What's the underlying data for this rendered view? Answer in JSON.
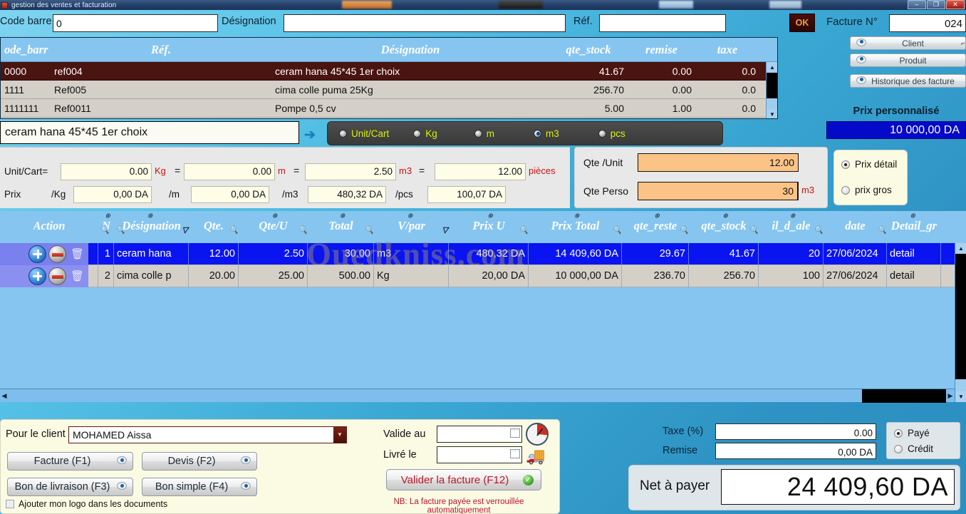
{
  "window": {
    "title": "gestion des ventes et facturation",
    "minimize": "–",
    "maximize": "❐",
    "close": "✕"
  },
  "search": {
    "codebarre_label": "Code barre",
    "codebarre_value": "0",
    "designation_label": "Désignation",
    "designation_value": "",
    "ref_label": "Réf.",
    "ref_value": "",
    "ok_label": "OK",
    "facture_no_label": "Facture N°",
    "facture_no_value": "024"
  },
  "side_buttons": {
    "client": "Client",
    "produit": "Produit",
    "historique": "Historique des facture",
    "prix_perso_label": "Prix personnalisé",
    "prix_perso_value": "10 000,00 DA"
  },
  "product_grid": {
    "columns": [
      "ode_barr",
      "Réf.",
      "Désignation",
      "qte_stock",
      "remise",
      "taxe"
    ],
    "rows": [
      {
        "code": "0000",
        "ref": "ref004",
        "designation": "ceram hana 45*45 1er choix",
        "qte_stock": "41.67",
        "remise": "0.00",
        "taxe": "0.0",
        "selected": true
      },
      {
        "code": "1111",
        "ref": "Ref005",
        "designation": "cima colle puma 25Kg",
        "qte_stock": "256.70",
        "remise": "0.00",
        "taxe": "0.0",
        "selected": false
      },
      {
        "code": "1111111",
        "ref": "Ref0011",
        "designation": "Pompe 0,5 cv",
        "qte_stock": "5.00",
        "remise": "1.00",
        "taxe": "0.0",
        "selected": false
      }
    ],
    "scroll_up": "▲",
    "scroll_down": "▼"
  },
  "selected_product": {
    "designation": "ceram hana 45*45 1er choix",
    "arrow": "➔"
  },
  "unit_selector": {
    "options": [
      {
        "label": "Unit/Cart",
        "selected": false
      },
      {
        "label": "Kg",
        "selected": false
      },
      {
        "label": "m",
        "selected": false
      },
      {
        "label": "m3",
        "selected": true
      },
      {
        "label": "pcs",
        "selected": false
      }
    ]
  },
  "conversion": {
    "row1_label": "Unit/Cart=",
    "kg_value": "0.00",
    "kg_unit": "Kg",
    "eq1": "=",
    "m_value": "0.00",
    "m_unit": "m",
    "eq2": "=",
    "m3_value": "2.50",
    "m3_unit": "m3",
    "eq3": "=",
    "pcs_value": "12.00",
    "pcs_unit": "pièces",
    "row2_label": "Prix",
    "per_kg_label": "/Kg",
    "per_kg_value": "0,00 DA",
    "per_m_label": "/m",
    "per_m_value": "0,00 DA",
    "per_m3_label": "/m3",
    "per_m3_value": "480,32 DA",
    "per_pcs_label": "/pcs",
    "per_pcs_value": "100,07 DA"
  },
  "qte_panel": {
    "qte_unit_label": "Qte /Unit",
    "qte_unit_value": "12.00",
    "qte_perso_label": "Qte Perso",
    "qte_perso_value": "30",
    "qte_perso_unit": "m3"
  },
  "price_type": {
    "detail_label": "Prix détail",
    "detail_selected": true,
    "gros_label": "prix gros",
    "gros_selected": false
  },
  "invoice_grid": {
    "columns": [
      "Action",
      "N",
      "Désignation",
      "Qte.",
      "Qte/U",
      "Total",
      "V/par",
      "Prix U",
      "Prix Total",
      "qte_reste",
      "qte_stock",
      "il_d_ale",
      "date",
      "Detail_gr"
    ],
    "rows": [
      {
        "n": "1",
        "designation": "ceram hana",
        "qte": "12.00",
        "qteu": "2.50",
        "total": "30.00",
        "vpar": "m3",
        "prix_u": "480,32 DA",
        "prix_total": "14 409,60 DA",
        "qte_reste": "29.67",
        "qte_stock": "41.67",
        "seuil": "20",
        "date": "27/06/2024",
        "detail": "detail",
        "selected": true
      },
      {
        "n": "2",
        "designation": "cima colle p",
        "qte": "20.00",
        "qteu": "25.00",
        "total": "500.00",
        "vpar": "Kg",
        "prix_u": "20,00 DA",
        "prix_total": "10 000,00 DA",
        "qte_reste": "236.70",
        "qte_stock": "256.70",
        "seuil": "100",
        "date": "27/06/2024",
        "detail": "detail",
        "selected": false
      }
    ],
    "watermark": "Ouedkniss.com",
    "scroll_up": "▲",
    "scroll_down": "▼",
    "scroll_left": "◀",
    "scroll_right": "▶"
  },
  "bottom": {
    "client_label": "Pour le client",
    "client_value": "MOHAMED Aissa",
    "facture_btn": "Facture (F1)",
    "devis_btn": "Devis (F2)",
    "bl_btn": "Bon de livraison (F3)",
    "bs_btn": "Bon simple (F4)",
    "logo_checkbox": "Ajouter mon logo dans les documents",
    "valide_label": "Valide au",
    "valide_value": "",
    "livre_label": "Livré le",
    "livre_value": "",
    "valider_btn": "Valider la facture (F12)",
    "valider_check": "✓",
    "nb_note": "NB: La facture payée est verrouillée automatiquement"
  },
  "totals": {
    "taxe_label": "Taxe (%)",
    "taxe_value": "0.00",
    "remise_label": "Remise",
    "remise_value": "0,00 DA",
    "paye_label": "Payé",
    "paye_selected": true,
    "credit_label": "Crédit",
    "credit_selected": false,
    "net_label": "Net à payer",
    "net_value": "24 409,60 DA"
  },
  "colors": {
    "accent_blue": "#0a14f0",
    "header_blue": "#86c5f0",
    "selected_row_brown": "#4a1410",
    "ok_button": "#4a0e0e",
    "prix_perso_bg": "#0509c8",
    "alert_red": "#c0152a"
  }
}
